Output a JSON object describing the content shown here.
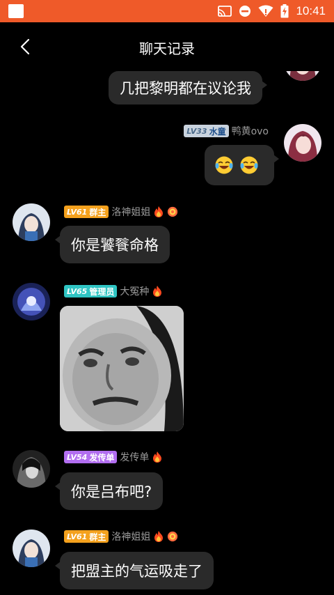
{
  "status_bar": {
    "time": "10:41"
  },
  "header": {
    "title": "聊天记录"
  },
  "messages": [
    {
      "kind": "text",
      "side": "me",
      "text": "几把黎明都在议论我"
    },
    {
      "kind": "emoji",
      "side": "me",
      "badge": {
        "level": "LV33",
        "role": "水童",
        "style": "gray"
      },
      "username": "鸭黄ovo",
      "emojis": [
        "laughing-tears-emoji",
        "laughing-tears-emoji"
      ]
    },
    {
      "kind": "text",
      "side": "other",
      "badge": {
        "level": "LV61",
        "role": "群主",
        "style": "orange"
      },
      "username": "洛神姐姐",
      "text": "你是饕餮命格"
    },
    {
      "kind": "image",
      "side": "other",
      "badge": {
        "level": "LV65",
        "role": "管理员",
        "style": "teal"
      },
      "username": "大冤种",
      "image": "meme-face"
    },
    {
      "kind": "text",
      "side": "other",
      "badge": {
        "level": "LV54",
        "role": "发传单",
        "style": "purple"
      },
      "username": "发传单",
      "text": "你是吕布吧?"
    },
    {
      "kind": "text",
      "side": "other",
      "badge": {
        "level": "LV61",
        "role": "群主",
        "style": "orange"
      },
      "username": "洛神姐姐",
      "text": "把盟主的气运吸走了"
    }
  ],
  "colors": {
    "status_bar": "#ef5a29",
    "bubble": "#2a2a2a",
    "background": "#000000"
  }
}
